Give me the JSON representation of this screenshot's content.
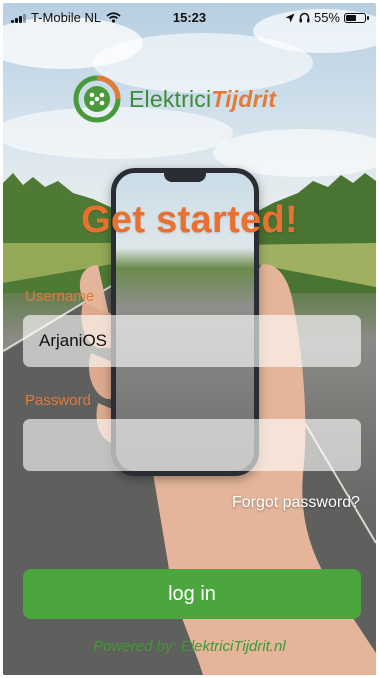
{
  "status_bar": {
    "carrier": "T-Mobile NL",
    "time": "15:23",
    "battery_percent": "55%",
    "battery_level": 0.55
  },
  "logo": {
    "text_part1": "Elektrici",
    "text_part2": "Tijdrit"
  },
  "title": "Get started!",
  "form": {
    "username_label": "Username",
    "username_value": "ArjaniOS",
    "password_label": "Password",
    "password_value": "",
    "forgot_label": "Forgot password?",
    "login_label": "log in"
  },
  "footer": {
    "powered_by": "Powered by: ElektriciTijdrit.nl"
  },
  "colors": {
    "brand_green": "#4aa63d",
    "brand_orange": "#ea7030"
  }
}
